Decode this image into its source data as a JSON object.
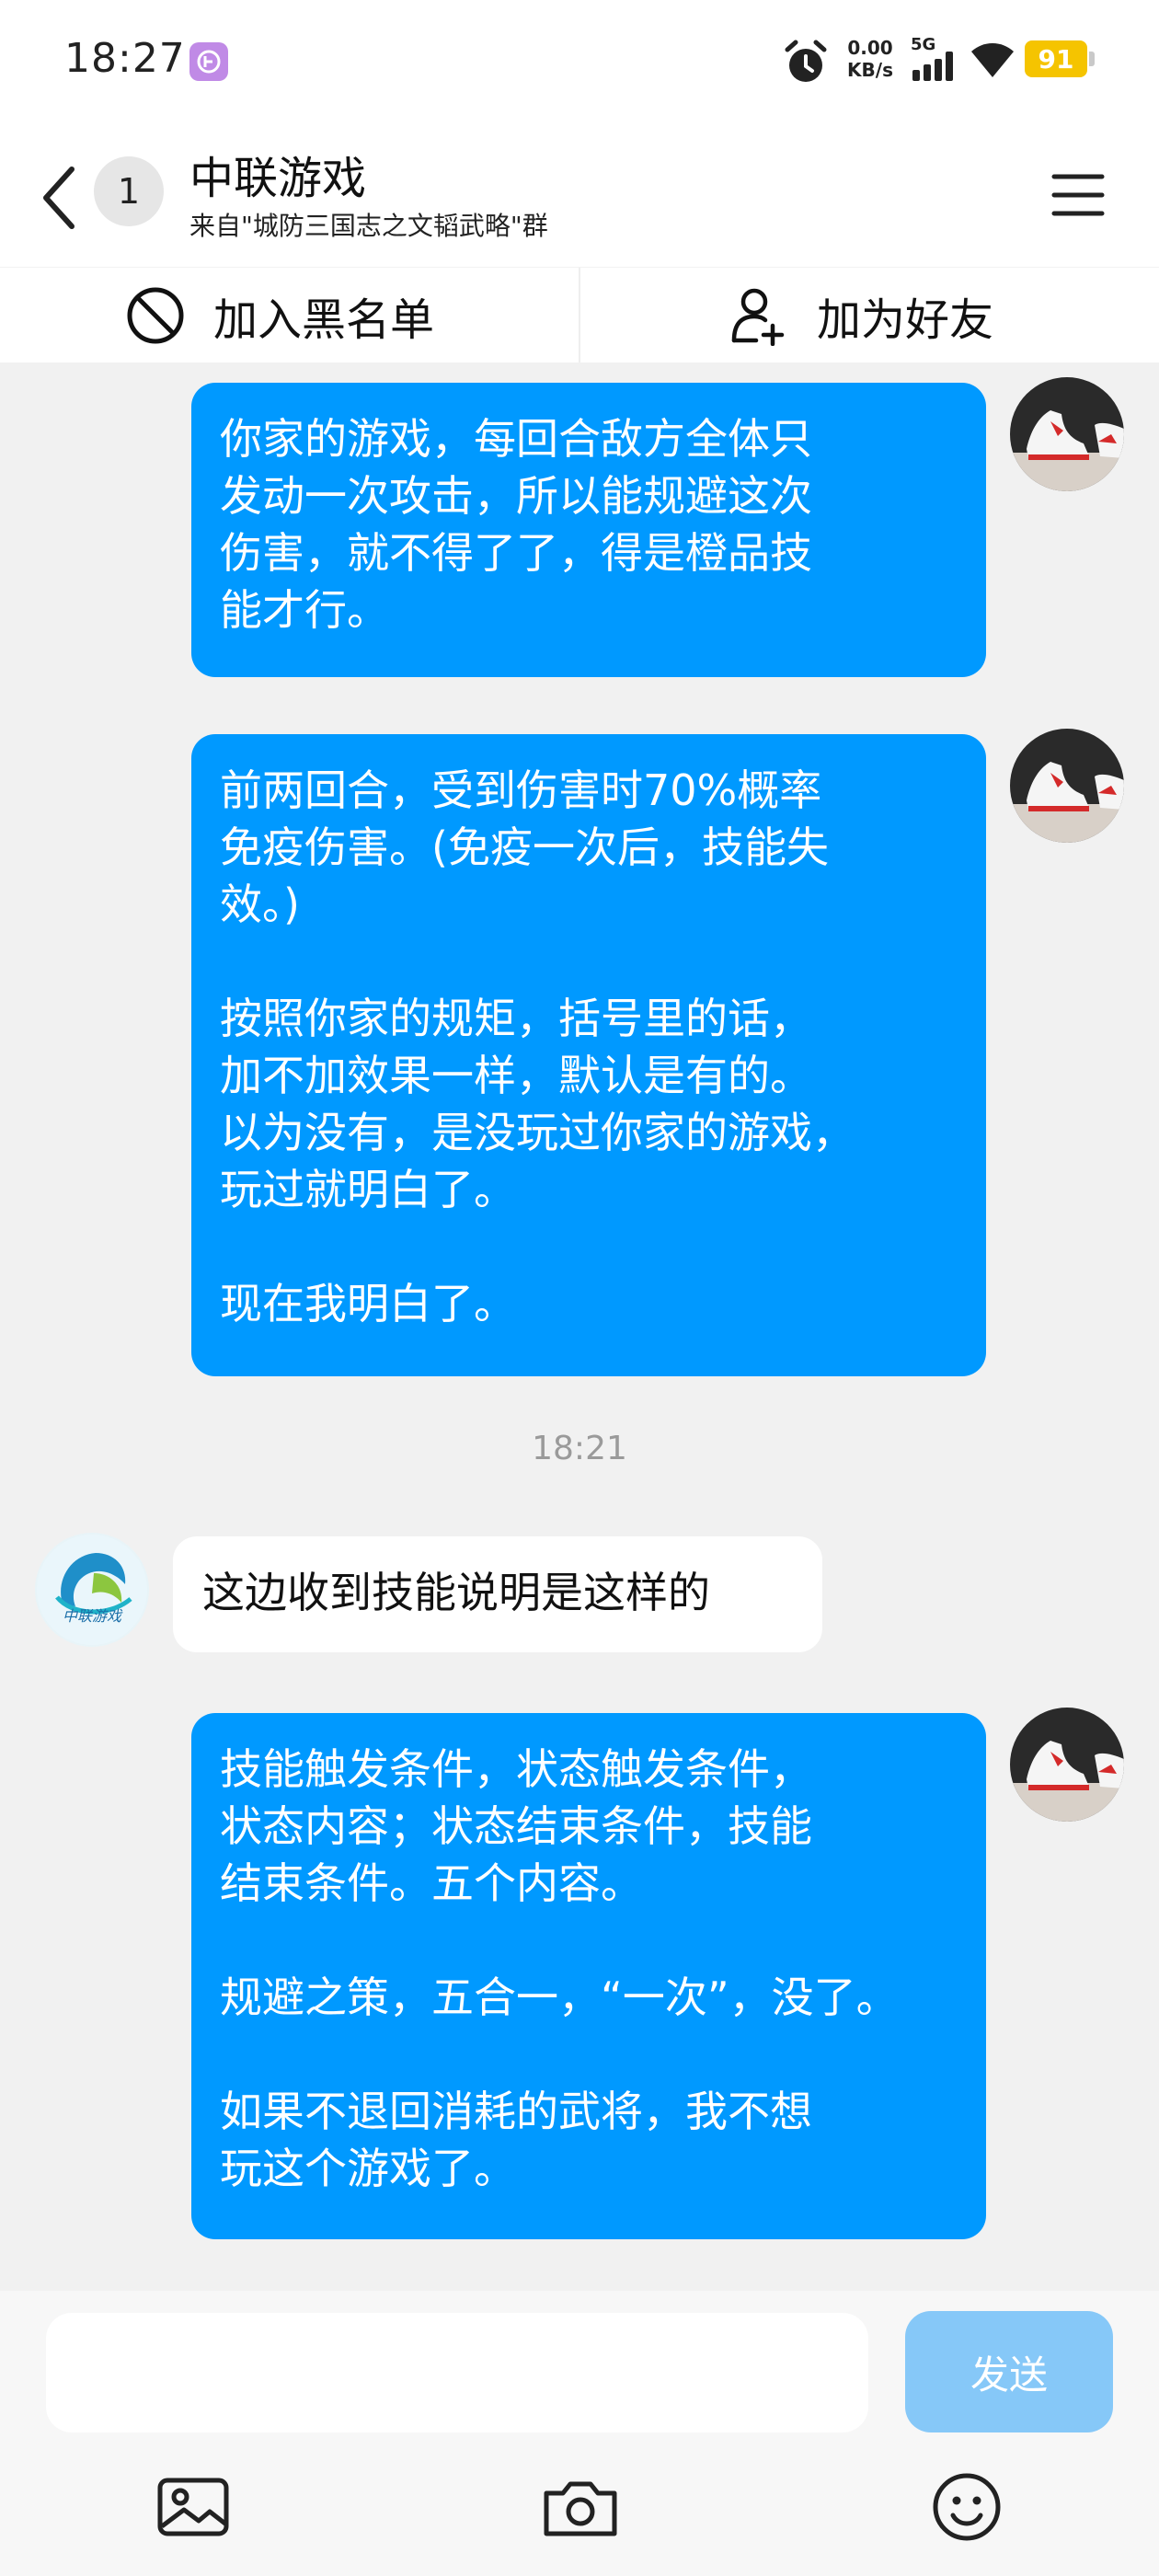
{
  "status_bar": {
    "time": "18:27",
    "net_speed_value": "0.00",
    "net_speed_unit": "KB/s",
    "network": "5G",
    "battery": "91"
  },
  "header": {
    "unread_count": "1",
    "title": "中联游戏",
    "subtitle": "来自\"城防三国志之文韬武略\"群"
  },
  "actions": {
    "blacklist_label": "加入黑名单",
    "add_friend_label": "加为好友"
  },
  "messages": [
    {
      "direction": "out",
      "text": "你家的游戏，每回合敌方全体只\n发动一次攻击，所以能规避这次\n伤害，就不得了了，得是橙品技\n能才行。"
    },
    {
      "direction": "out",
      "text": "前两回合，受到伤害时70%概率\n免疫伤害。(免疫一次后，技能失\n效。)\n\n按照你家的规矩，括号里的话，\n加不加效果一样，默认是有的。\n以为没有，是没玩过你家的游戏，\n玩过就明白了。\n\n现在我明白了。"
    },
    {
      "timestamp": "18:21"
    },
    {
      "direction": "in",
      "text": "这边收到技能说明是这样的",
      "avatar_caption": "中联游戏"
    },
    {
      "direction": "out",
      "text": "技能触发条件，状态触发条件，\n状态内容；状态结束条件，技能\n结束条件。五个内容。\n\n规避之策，五合一，“一次”，没了。\n\n如果不退回消耗的武将，我不想\n玩这个游戏了。"
    }
  ],
  "input": {
    "value": "",
    "send_label": "发送"
  },
  "colors": {
    "outgoing_bubble": "#0099ff",
    "incoming_bubble": "#ffffff",
    "send_button_disabled": "#86c8f8",
    "chat_background": "#f1f1f1"
  },
  "icons": [
    "back-icon",
    "menu-icon",
    "block-icon",
    "add-friend-icon",
    "image-icon",
    "camera-icon",
    "emoji-icon",
    "alarm-icon",
    "signal-icon",
    "wifi-icon"
  ]
}
